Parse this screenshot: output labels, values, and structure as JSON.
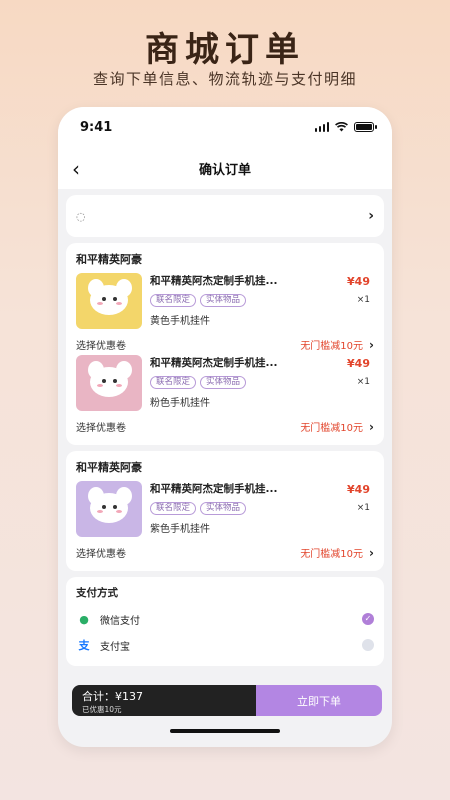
{
  "headline": "商城订单",
  "subheadline": "查询下单信息、物流轨迹与支付明细",
  "statusbar": {
    "time": "9:41"
  },
  "nav": {
    "title": "确认订单"
  },
  "address": {
    "icon": "location-icon"
  },
  "shops": [
    {
      "name": "和平精英阿豪",
      "items": [
        {
          "title": "和平精英阿杰定制手机挂...",
          "tags": [
            "联名限定",
            "实体物品"
          ],
          "variant": "黄色手机挂件",
          "price": "¥49",
          "qty": "×1",
          "thumb_color": "#f3d66a"
        },
        {
          "title": "和平精英阿杰定制手机挂...",
          "tags": [
            "联名限定",
            "实体物品"
          ],
          "variant": "粉色手机挂件",
          "price": "¥49",
          "qty": "×1",
          "thumb_color": "#e9b5c4"
        }
      ],
      "coupon_label": "选择优惠卷",
      "coupon_values": [
        "无门槛减10元",
        "无门槛减10元"
      ]
    },
    {
      "name": "和平精英阿豪",
      "items": [
        {
          "title": "和平精英阿杰定制手机挂...",
          "tags": [
            "联名限定",
            "实体物品"
          ],
          "variant": "紫色手机挂件",
          "price": "¥49",
          "qty": "×1",
          "thumb_color": "#c9b6e6"
        }
      ],
      "coupon_label": "选择优惠卷",
      "coupon_values": [
        "无门槛减10元"
      ]
    }
  ],
  "payment": {
    "title": "支付方式",
    "options": [
      {
        "label": "微信支付",
        "icon": "wechat-icon",
        "selected": true
      },
      {
        "label": "支付宝",
        "icon": "alipay-icon",
        "selected": false
      }
    ]
  },
  "footer": {
    "total_label": "合计：",
    "total_value": "¥137",
    "discount": "已优惠10元",
    "submit_label": "立即下单"
  },
  "colors": {
    "accent": "#b386e3",
    "price": "#e2452c"
  }
}
